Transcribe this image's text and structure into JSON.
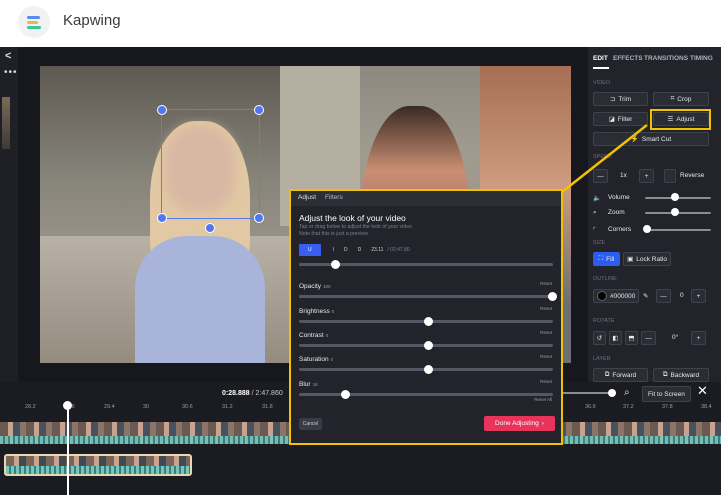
{
  "brand": "Kapwing",
  "tabs": [
    "EDIT",
    "EFFECTS",
    "TRANSITIONS",
    "TIMING"
  ],
  "sections": {
    "video": "VIDEO",
    "speed": "SPEED",
    "size": "SIZE",
    "outline": "OUTLINE",
    "rotate": "ROTATE",
    "layer": "LAYER"
  },
  "buttons": {
    "trim": "Trim",
    "crop": "Crop",
    "filter": "Filter",
    "adjust": "Adjust",
    "smart_cut": "Smart Cut",
    "reverse": "Reverse",
    "fill": "Fill",
    "lock_ratio": "Lock Ratio",
    "forward": "Forward",
    "backward": "Backward",
    "fit_to_screen": "Fit to Screen"
  },
  "speed": {
    "value": "1x"
  },
  "sliders": {
    "volume": "Volume",
    "zoom": "Zoom",
    "corners": "Corners"
  },
  "outline": {
    "color": "#000000",
    "value": "0"
  },
  "rotate": {
    "value": "0°"
  },
  "popup": {
    "tab_adjust": "Adjust",
    "tab_filters": "Filters",
    "title": "Adjust the look of your video",
    "subtitle_1": "Tap or drag below to adjust the look of your video",
    "subtitle_2": "Note that this is just a preview",
    "segments": [
      "U",
      "I",
      "D",
      "D",
      "23.11",
      "/ 02:47.80"
    ],
    "rows": [
      {
        "label": "Opacity",
        "value": "100",
        "reset": "Reset",
        "level": 1.0
      },
      {
        "label": "Brightness",
        "value": "0",
        "reset": "Reset",
        "level": 0.5
      },
      {
        "label": "Contrast",
        "value": "0",
        "reset": "Reset",
        "level": 0.5
      },
      {
        "label": "Saturation",
        "value": "0",
        "reset": "Reset",
        "level": 0.5
      },
      {
        "label": "Blur",
        "value": "16",
        "reset": "Reset",
        "level": 0.17
      }
    ],
    "reset_all": "Reset All",
    "cancel": "Cancel",
    "done": "Done Adjusting"
  },
  "timeline": {
    "current": "0:28.888",
    "total": "/ 2:47.860",
    "ticks": [
      "28.2",
      "28.6",
      "29.4",
      "30",
      "30.6",
      "31.2",
      "31.8",
      "36.6",
      "37.2",
      "37.8",
      "38.4"
    ]
  },
  "colors": {
    "accent": "#2d5cf0",
    "highlight": "#f2c200",
    "done": "#e8335a"
  }
}
